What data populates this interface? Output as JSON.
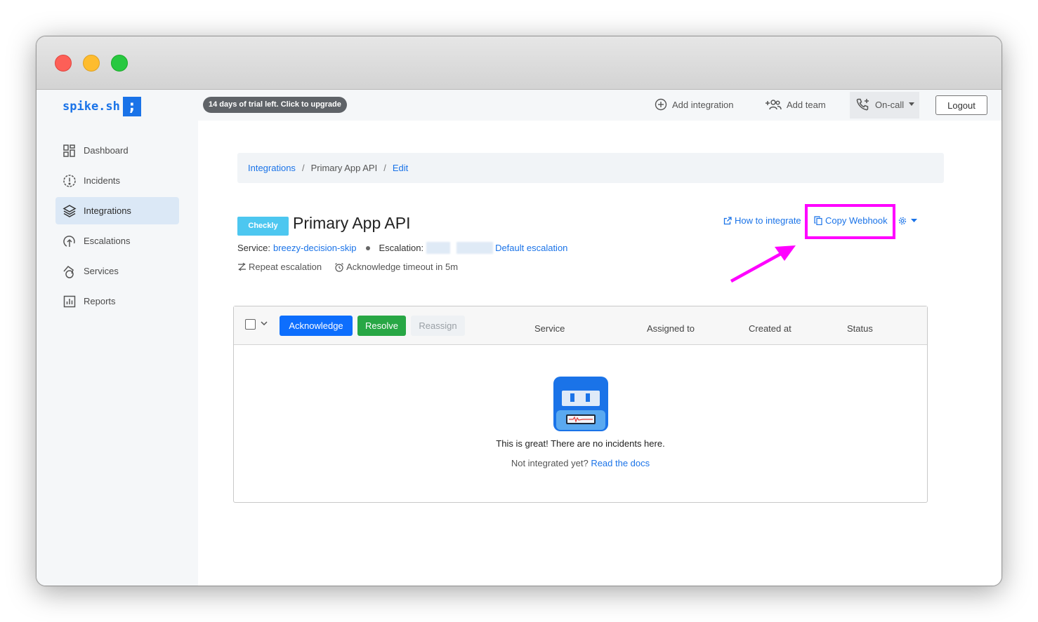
{
  "brand": {
    "name": "spike.sh",
    "mark": ";"
  },
  "sidebar": {
    "items": [
      {
        "label": "Dashboard",
        "icon": "dashboard-icon"
      },
      {
        "label": "Incidents",
        "icon": "incidents-icon"
      },
      {
        "label": "Integrations",
        "icon": "layers-icon",
        "active": true
      },
      {
        "label": "Escalations",
        "icon": "escalation-icon"
      },
      {
        "label": "Services",
        "icon": "services-icon"
      },
      {
        "label": "Reports",
        "icon": "reports-icon"
      }
    ]
  },
  "topbar": {
    "trial_label": "14 days of trial left. Click to upgrade",
    "add_integration": "Add integration",
    "add_team": "Add team",
    "oncall": "On-call",
    "logout": "Logout"
  },
  "breadcrumb": {
    "items": [
      "Integrations",
      "Primary App API",
      "Edit"
    ]
  },
  "integration": {
    "tag": "Checkly",
    "title": "Primary App API",
    "service_label": "Service:",
    "service_value": "breezy-decision-skip",
    "escalation_label": "Escalation:",
    "escalation_value": "Default escalation",
    "repeat_escalation": "Repeat escalation",
    "ack_timeout": "Acknowledge timeout in 5m",
    "how_to_integrate": "How to integrate",
    "copy_webhook": "Copy Webhook"
  },
  "table": {
    "buttons": {
      "acknowledge": "Acknowledge",
      "resolve": "Resolve",
      "reassign": "Reassign"
    },
    "columns": [
      "Service",
      "Assigned to",
      "Created at",
      "Status"
    ],
    "empty_message": "This is great! There are no incidents here.",
    "empty_sub": "Not integrated yet?",
    "empty_link": "Read the docs"
  },
  "colors": {
    "accent": "#1a73e8",
    "highlight": "#ff00ff",
    "success": "#28a745"
  }
}
